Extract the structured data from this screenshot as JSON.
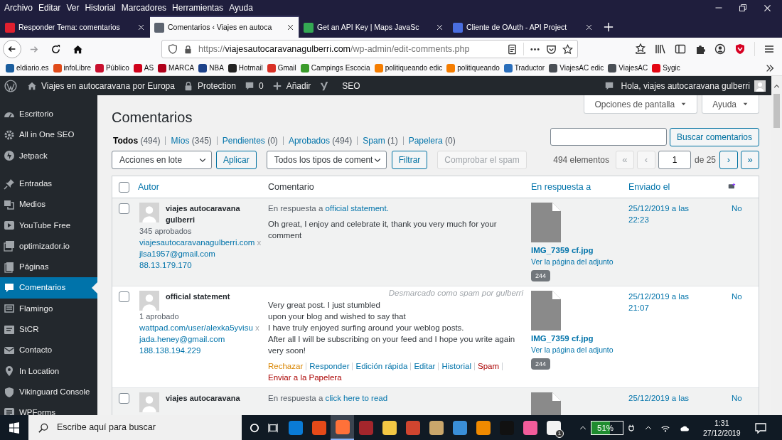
{
  "menu_bar": [
    "Archivo",
    "Editar",
    "Ver",
    "Historial",
    "Marcadores",
    "Herramientas",
    "Ayuda"
  ],
  "tabs": [
    {
      "title": "Responder Tema: comentarios",
      "color": "#e0202f",
      "selected": false
    },
    {
      "title": "Comentarios ‹ Viajes en autoca",
      "color": "#5d6470",
      "selected": true
    },
    {
      "title": "Get an API Key | Maps JavaSc",
      "color": "#34a853",
      "selected": false
    },
    {
      "title": "Cliente de OAuth - API Project",
      "color": "#4a6ee0",
      "selected": false
    }
  ],
  "address": {
    "scheme": "https://",
    "host": "viajesautocaravanagulberri.com",
    "path": "/wp-admin/edit-comments.php"
  },
  "bookmarks": [
    {
      "label": "eldiario.es",
      "color": "#1b5e9e"
    },
    {
      "label": "infoLibre",
      "color": "#e04b1a"
    },
    {
      "label": "Público",
      "color": "#c8102e"
    },
    {
      "label": "AS",
      "color": "#d0021b"
    },
    {
      "label": "MARCA",
      "color": "#b0001b"
    },
    {
      "label": "NBA",
      "color": "#1d428a"
    },
    {
      "label": "Hotmail",
      "color": "#222222"
    },
    {
      "label": "Gmail",
      "color": "#d93025"
    },
    {
      "label": "Campings Escocia",
      "color": "#3a9b2b"
    },
    {
      "label": "politiqueando edic",
      "color": "#f57d00"
    },
    {
      "label": "politiqueando",
      "color": "#f57d00"
    },
    {
      "label": "Traductor",
      "color": "#2a6ebb"
    },
    {
      "label": "ViajesAC edic",
      "color": "#4a4f55"
    },
    {
      "label": "ViajesAC",
      "color": "#4a4f55"
    },
    {
      "label": "Sygic",
      "color": "#e30613"
    }
  ],
  "admin_bar": {
    "site": "Viajes en autocaravana por Europa",
    "protection": "Protection",
    "comments": "0",
    "add": "Añadir",
    "seo": "SEO",
    "greeting": "Hola, viajes autocaravana gulberri"
  },
  "sidebar": {
    "sections": [
      {
        "items": [
          {
            "label": "Escritorio",
            "selected": false
          },
          {
            "label": "All in One SEO",
            "selected": false
          },
          {
            "label": "Jetpack",
            "selected": false
          }
        ]
      },
      {
        "items": [
          {
            "label": "Entradas",
            "selected": false
          },
          {
            "label": "Medios",
            "selected": false
          },
          {
            "label": "YouTube Free",
            "selected": false
          },
          {
            "label": "optimizador.io",
            "selected": false
          },
          {
            "label": "Páginas",
            "selected": false
          },
          {
            "label": "Comentarios",
            "selected": true
          },
          {
            "label": "Flamingo",
            "selected": false
          },
          {
            "label": "StCR",
            "selected": false
          },
          {
            "label": "Contacto",
            "selected": false
          },
          {
            "label": "In Location",
            "selected": false
          },
          {
            "label": "Vikinguard Console",
            "selected": false
          },
          {
            "label": "WPForms",
            "selected": false
          }
        ]
      }
    ]
  },
  "screen_options": [
    "Opciones de pantalla",
    "Ayuda"
  ],
  "page_title": "Comentarios",
  "filters": [
    {
      "label": "Todos",
      "count": "(494)",
      "selected": true
    },
    {
      "label": "Míos",
      "count": "(345)",
      "selected": false
    },
    {
      "label": "Pendientes",
      "count": "(0)",
      "selected": false
    },
    {
      "label": "Aprobados",
      "count": "(494)",
      "selected": false
    },
    {
      "label": "Spam",
      "count": "(1)",
      "selected": false
    },
    {
      "label": "Papelera",
      "count": "(0)",
      "selected": false
    }
  ],
  "search_button": "Buscar comentarios",
  "bulk_actions": {
    "value": "Acciones en lote",
    "apply": "Aplicar"
  },
  "type_filter": {
    "value": "Todos los tipos de coment",
    "filter": "Filtrar"
  },
  "spam_check": {
    "label": "Comprobar el spam",
    "disabled": true
  },
  "pagination": {
    "count": "494 elementos",
    "first": {
      "label": "«",
      "disabled": true
    },
    "prev": {
      "label": "‹",
      "disabled": true
    },
    "page": "1",
    "of": "de 25",
    "next": {
      "label": "›",
      "disabled": false
    },
    "last": {
      "label": "»",
      "disabled": false
    }
  },
  "table": {
    "select_all_checked": false,
    "columns": [
      "Autor",
      "Comentario",
      "En respuesta a",
      "Enviado el"
    ],
    "rows": [
      {
        "checked": false,
        "shaded": true,
        "author": "viajes autocaravana gulberri",
        "approved": "345 aprobados",
        "url": "viajesautocaravanagulberri.com",
        "url_mark": "x",
        "email": "jlsa1957@gmail.com",
        "ip": "88.13.179.170",
        "reply_prefix": "En respuesta a",
        "reply_to": "official statement.",
        "text_lines": [
          "Oh great, I enjoy and celebrate it, thank you very much for your comment"
        ],
        "attachment": "IMG_7359 cf.jpg",
        "attachment_link": "Ver la página del adjunto",
        "comment_count": "244",
        "date": "25/12/2019 a las 22:23",
        "pending": "No"
      },
      {
        "checked": false,
        "shaded": false,
        "author": "official statement",
        "approved": "1 aprobado",
        "url": "wattpad.com/user/alexka5yvisu",
        "url_mark": "x",
        "email": "jada.heney@gmail.com",
        "ip": "188.138.194.229",
        "note": "Desmarcado como spam por gulberri",
        "text_lines": [
          "Very great post. I just stumbled",
          "upon your blog and wished to say that",
          "I have truly enjoyed surfing around your weblog posts.",
          "After all I will be subscribing on your feed and I hope you write again very soon!"
        ],
        "actions": [
          {
            "label": "Rechazar",
            "kind": "warn"
          },
          {
            "label": "Responder",
            "kind": "link"
          },
          {
            "label": "Edición rápida",
            "kind": "link"
          },
          {
            "label": "Editar",
            "kind": "link"
          },
          {
            "label": "Historial",
            "kind": "link"
          },
          {
            "label": "Spam",
            "kind": "danger"
          },
          {
            "label": "Enviar a la Papelera",
            "kind": "danger"
          }
        ],
        "attachment": "IMG_7359 cf.jpg",
        "attachment_link": "Ver la página del adjunto",
        "comment_count": "244",
        "date": "25/12/2019 a las 21:07",
        "pending": "No"
      },
      {
        "checked": false,
        "shaded": true,
        "author": "viajes autocaravana",
        "reply_prefix": "En respuesta a",
        "reply_to": "click here to read",
        "date": "25/12/2019 a las",
        "pending": "No"
      }
    ]
  },
  "taskbar": {
    "search_placeholder": "Escribe aquí para buscar",
    "apps": [
      {
        "color": "#0a7bd6",
        "selected": false
      },
      {
        "color": "#e64a19",
        "selected": false
      },
      {
        "color": "#ff7139",
        "selected": true
      },
      {
        "color": "#a4262c",
        "selected": false
      },
      {
        "color": "#f2c744",
        "selected": false
      },
      {
        "color": "#d0452f",
        "selected": false
      },
      {
        "color": "#c9a66b",
        "selected": false
      },
      {
        "color": "#3a8fd8",
        "selected": false
      },
      {
        "color": "#f08a00",
        "selected": false
      },
      {
        "color": "#111111",
        "selected": false
      },
      {
        "color": "#f25c9b",
        "selected": false
      },
      {
        "color": "#f2f2f2",
        "selected": false
      }
    ],
    "mail_badge": "1",
    "battery": "51%",
    "time": "1:31",
    "date": "27/12/2019"
  }
}
